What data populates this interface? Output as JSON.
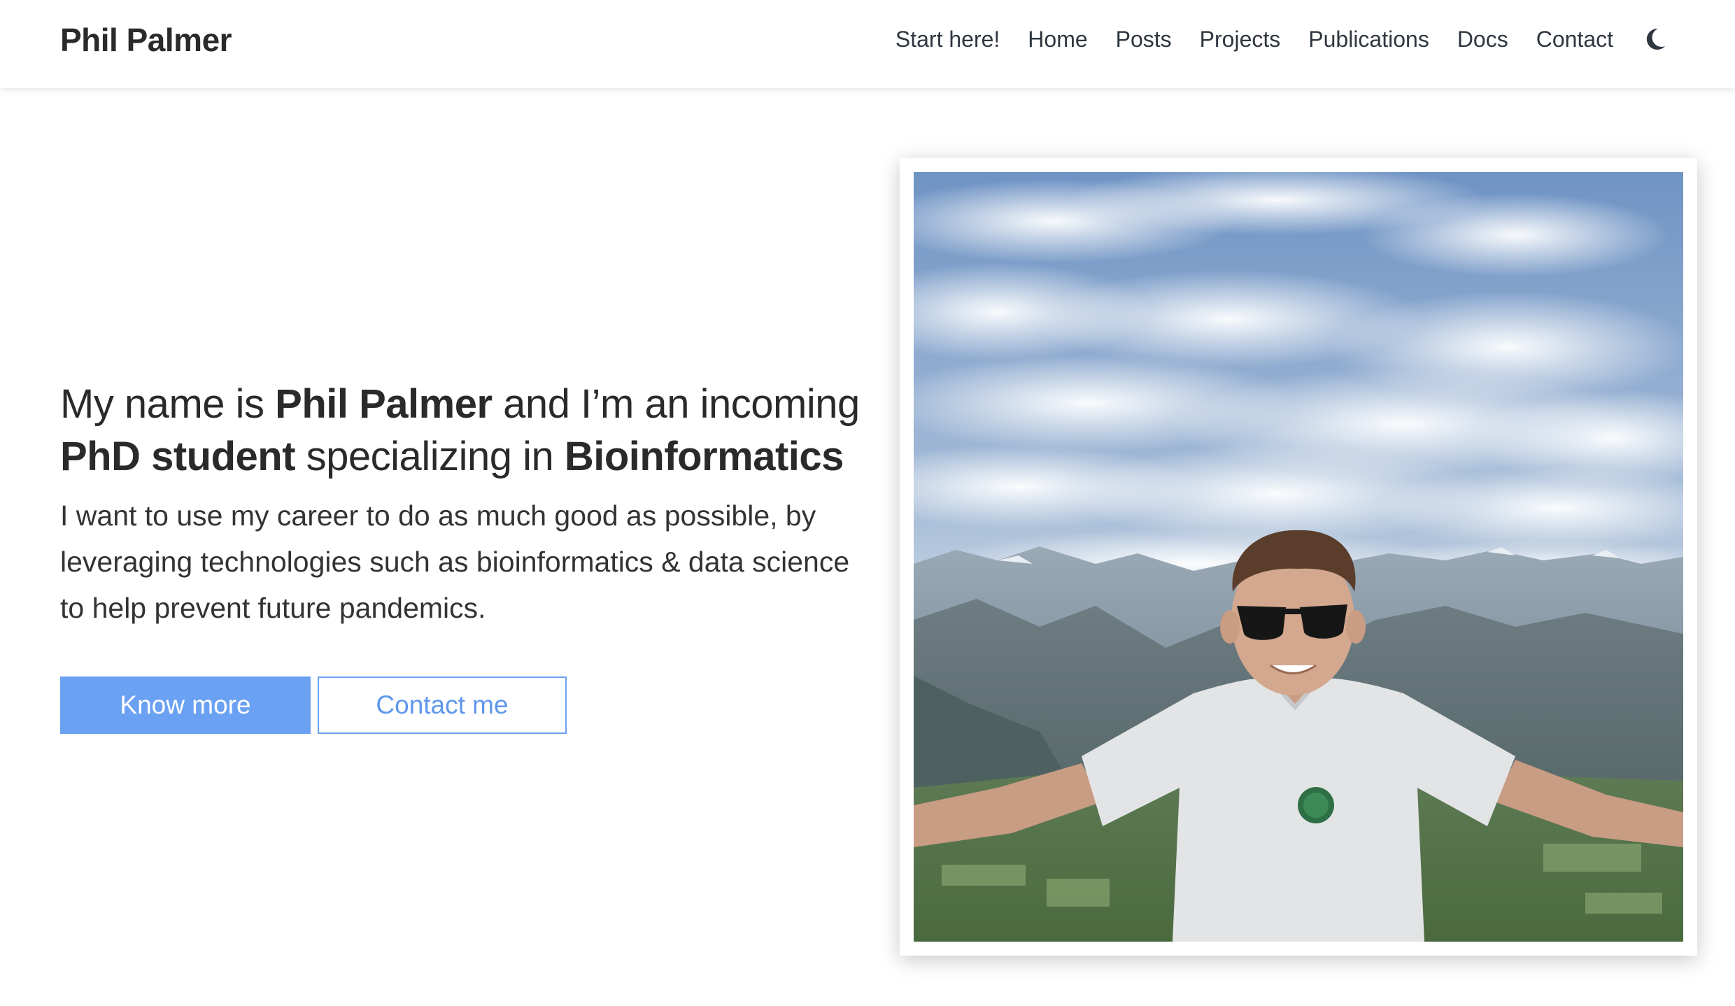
{
  "header": {
    "brand": "Phil Palmer",
    "nav": [
      {
        "label": "Start here!"
      },
      {
        "label": "Home"
      },
      {
        "label": "Posts"
      },
      {
        "label": "Projects"
      },
      {
        "label": "Publications"
      },
      {
        "label": "Docs"
      },
      {
        "label": "Contact"
      }
    ],
    "theme_toggle_icon": "moon-icon"
  },
  "hero": {
    "heading": {
      "t1": "My name is ",
      "name": "Phil Palmer",
      "t2": " and I’m an incoming ",
      "role": "PhD student",
      "t3": " specializing in ",
      "field": "Bioinformatics"
    },
    "subtitle": "I want to use my career to do as much good as possible, by leveraging technologies such as bioinformatics & data science to help prevent future pandemics.",
    "buttons": {
      "primary": "Know more",
      "secondary": "Contact me"
    }
  },
  "colors": {
    "accent": "#6aa1f2",
    "text": "#333333"
  }
}
